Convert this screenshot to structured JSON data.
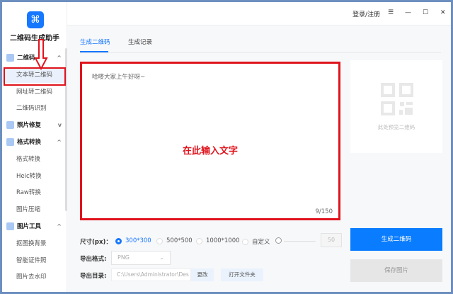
{
  "app": {
    "title": "二维码生成助手"
  },
  "sidebar": {
    "items": [
      {
        "label": "二维码",
        "type": "section",
        "chevron": "^"
      },
      {
        "label": "文本转二维码",
        "type": "item",
        "active": true
      },
      {
        "label": "网址转二维码",
        "type": "item"
      },
      {
        "label": "二维码识别",
        "type": "item"
      },
      {
        "label": "照片修复",
        "type": "section",
        "chevron": "v"
      },
      {
        "label": "格式转换",
        "type": "section",
        "chevron": "^"
      },
      {
        "label": "格式转换",
        "type": "item"
      },
      {
        "label": "Heic转换",
        "type": "item"
      },
      {
        "label": "Raw转换",
        "type": "item"
      },
      {
        "label": "图片压缩",
        "type": "item"
      },
      {
        "label": "图片工具",
        "type": "section",
        "chevron": "^"
      },
      {
        "label": "抠图换背景",
        "type": "item"
      },
      {
        "label": "智能证件照",
        "type": "item"
      },
      {
        "label": "图片去水印",
        "type": "item"
      }
    ]
  },
  "header": {
    "login": "登录/注册",
    "menu": "☰",
    "minimize": "—",
    "maximize": "☐",
    "close": "✕"
  },
  "tabs": [
    {
      "label": "生成二维码",
      "active": true
    },
    {
      "label": "生成记录"
    }
  ],
  "editor": {
    "value": "哈喽大家上午好呀~",
    "count": "9/150",
    "annotation": "在此输入文字"
  },
  "preview": {
    "placeholder": "此处预览二维码"
  },
  "size": {
    "label": "尺寸(px)：",
    "options": [
      "300*300",
      "500*500",
      "1000*1000",
      "自定义"
    ],
    "selected": "300*300",
    "custom_value": "50"
  },
  "format": {
    "label": "导出格式:",
    "value": "PNG",
    "chevron": "⌄"
  },
  "dir": {
    "label": "导出目录:",
    "value": "C:\\Users\\Administrator\\Des",
    "change": "更改",
    "open": "打开文件夹"
  },
  "actions": {
    "generate": "生成二维码",
    "save": "保存图片"
  },
  "colors": {
    "accent": "#1677ff",
    "annotation": "#e0131c"
  }
}
